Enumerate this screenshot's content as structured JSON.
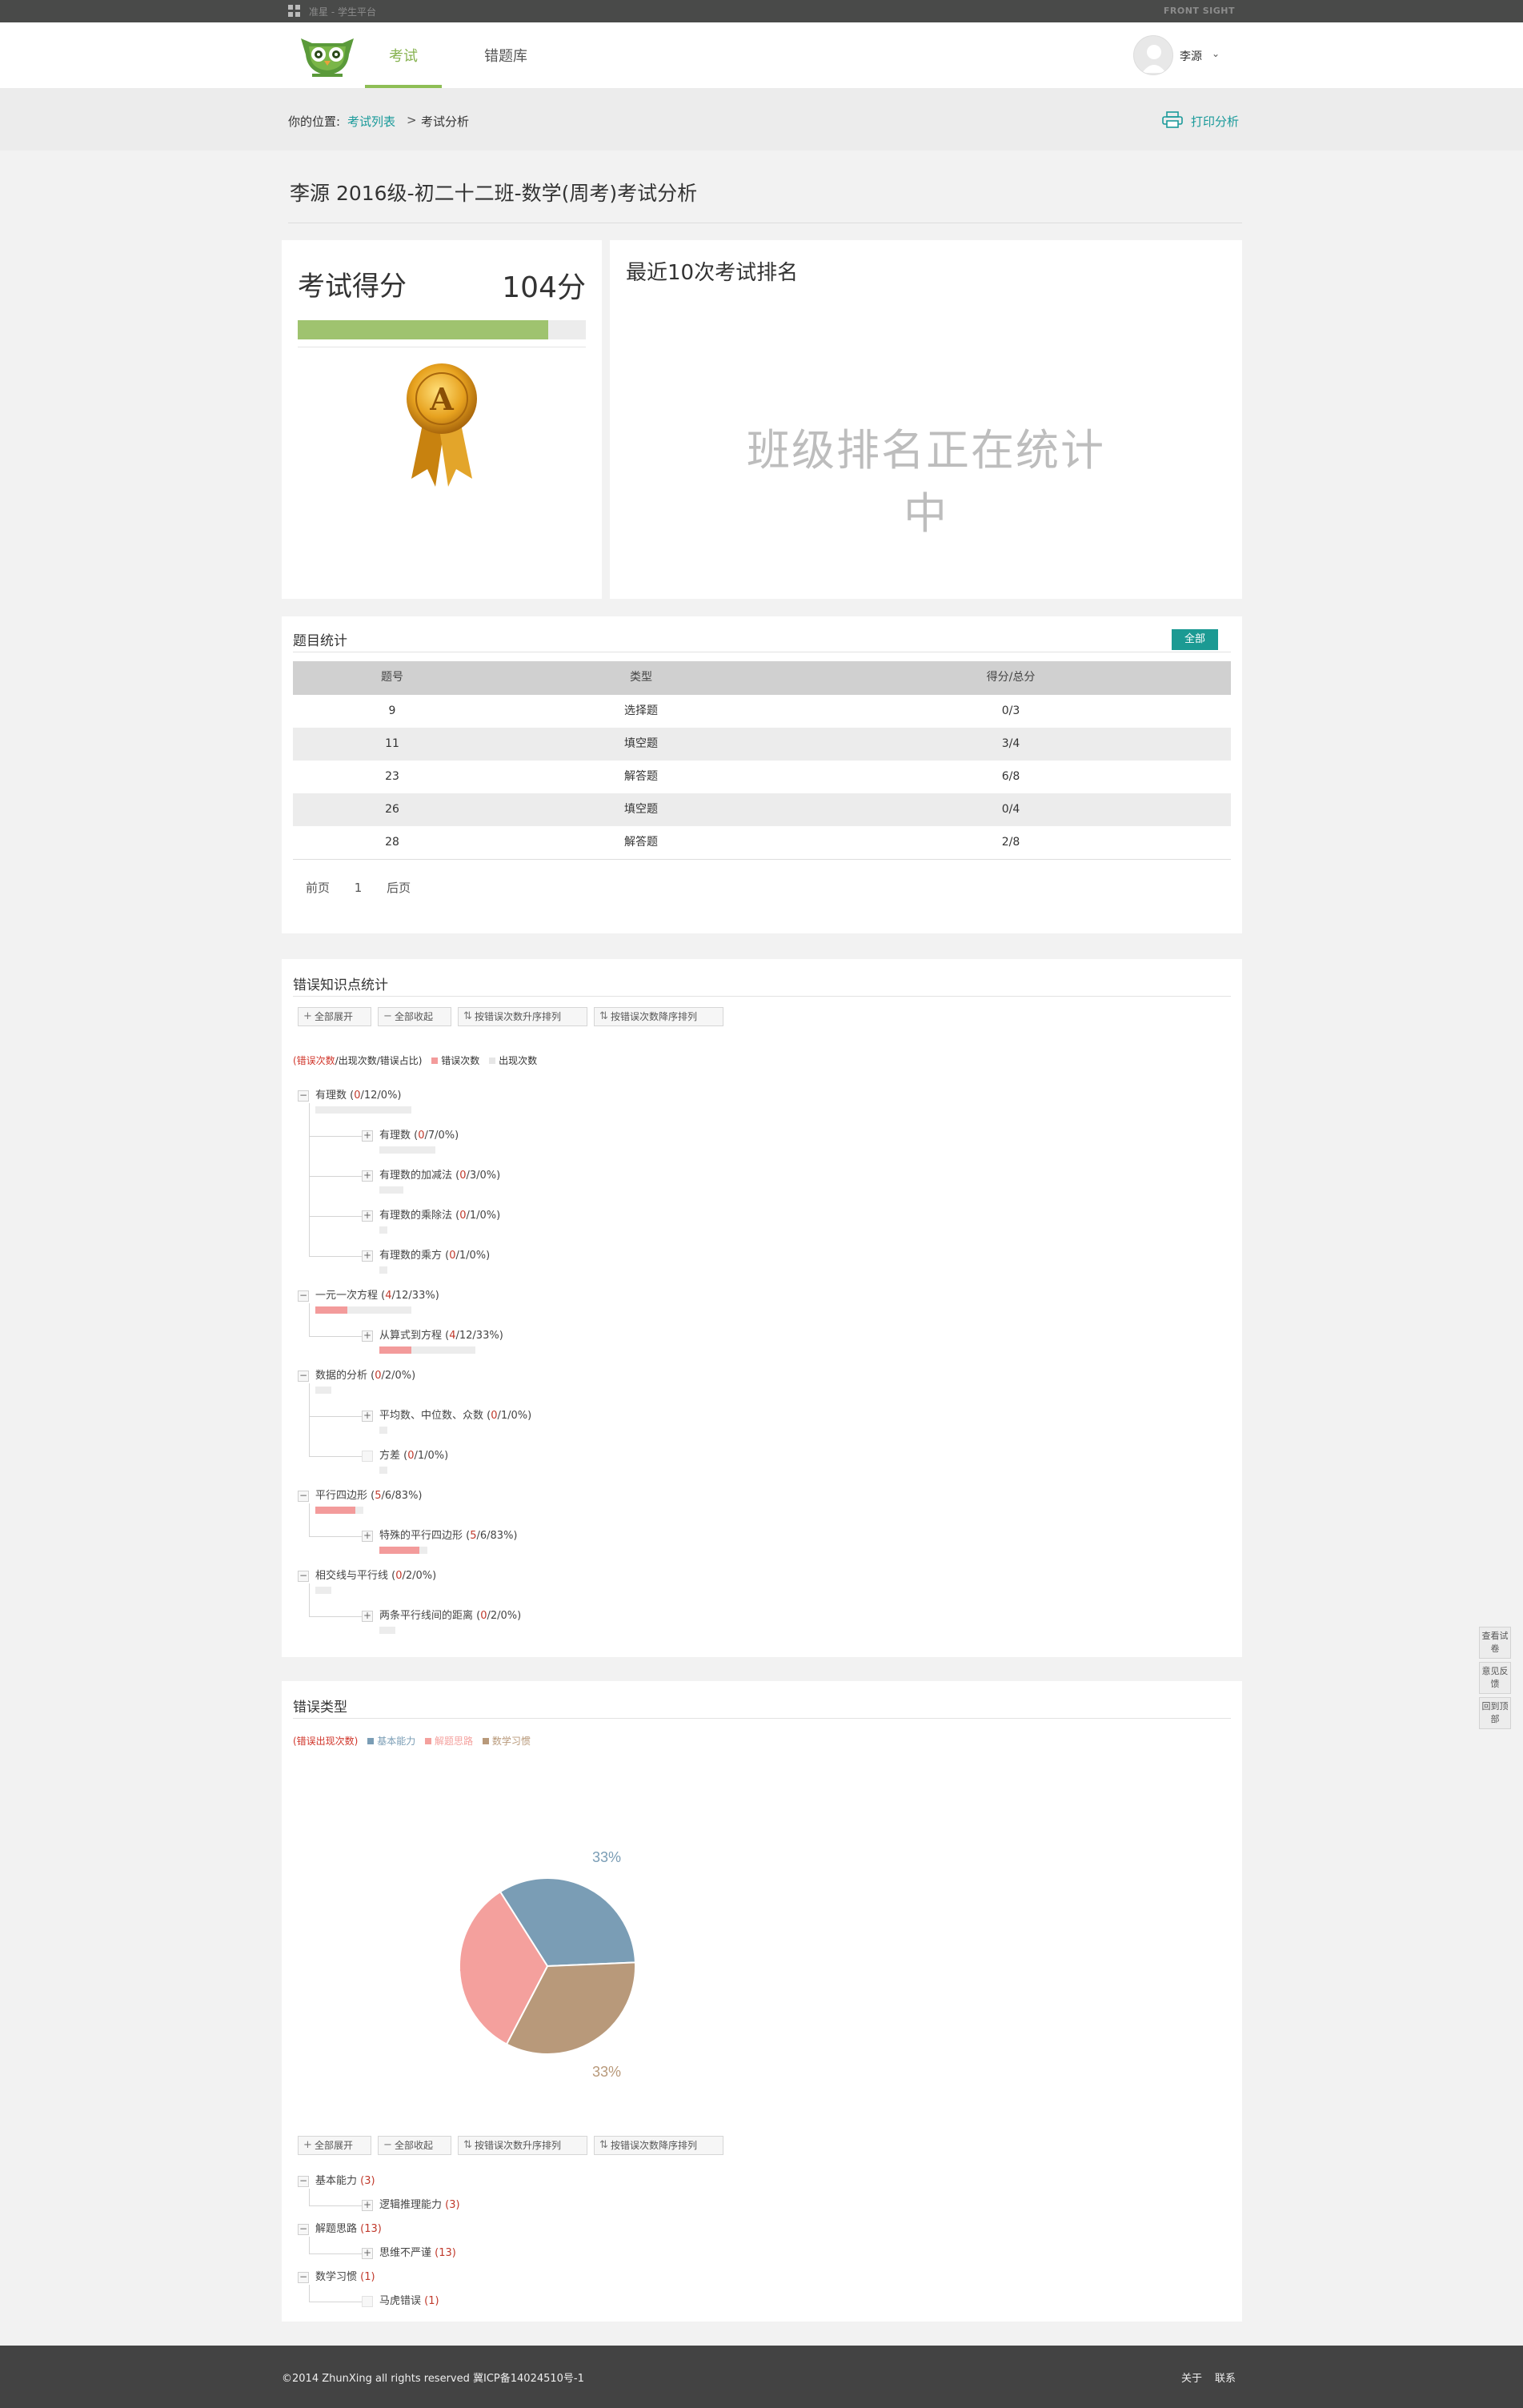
{
  "topbar": {
    "title": "准星 - 学生平台",
    "brand": "FRONT SIGHT"
  },
  "nav": {
    "tabs": [
      "考试",
      "错题库"
    ],
    "active": "考试"
  },
  "user": {
    "name": "李源"
  },
  "breadcrumb": {
    "label": "你的位置:",
    "link": "考试列表",
    "separator": ">",
    "current": "考试分析"
  },
  "print_label": "打印分析",
  "page_title": "李源 2016级-初二十二班-数学(周考)考试分析",
  "score": {
    "label": "考试得分",
    "value": "104分",
    "fraction": 0.87
  },
  "medal": {
    "letter": "A"
  },
  "rank": {
    "title": "最近10次考试排名",
    "status": "班级排名正在统计中"
  },
  "question_stats": {
    "title": "题目统计",
    "filter_label": "全部",
    "headers": [
      "题号",
      "类型",
      "得分/总分"
    ],
    "rows": [
      [
        "9",
        "选择题",
        "0/3"
      ],
      [
        "11",
        "填空题",
        "3/4"
      ],
      [
        "23",
        "解答题",
        "6/8"
      ],
      [
        "26",
        "填空题",
        "0/4"
      ],
      [
        "28",
        "解答题",
        "2/8"
      ]
    ],
    "pager": {
      "prev": "前页",
      "page": "1",
      "next": "后页"
    }
  },
  "toolbar": {
    "expand_all": "全部展开",
    "collapse_all": "全部收起",
    "sort_asc": "按错误次数升序排列",
    "sort_desc": "按错误次数降序排列"
  },
  "knowledge": {
    "title": "错误知识点统计",
    "legend": {
      "metric_red": "(错误次数",
      "metric_rest": "/出现次数/错误占比)",
      "wrong": "错误次数",
      "appear": "出现次数"
    },
    "colors": {
      "wrong": "#f39b9b",
      "appear": "#e6e6e6"
    },
    "nodes": [
      {
        "name": "有理数",
        "stat": "(0/12/0%)",
        "wrong": 0,
        "total": 12,
        "level": 0
      },
      {
        "name": "有理数",
        "stat": "(0/7/0%)",
        "wrong": 0,
        "total": 7,
        "level": 1
      },
      {
        "name": "有理数的加减法",
        "stat": "(0/3/0%)",
        "wrong": 0,
        "total": 3,
        "level": 1
      },
      {
        "name": "有理数的乘除法",
        "stat": "(0/1/0%)",
        "wrong": 0,
        "total": 1,
        "level": 1
      },
      {
        "name": "有理数的乘方",
        "stat": "(0/1/0%)",
        "wrong": 0,
        "total": 1,
        "level": 1
      },
      {
        "name": "一元一次方程",
        "stat": "(4/12/33%)",
        "wrong": 4,
        "total": 12,
        "level": 0
      },
      {
        "name": "从算式到方程",
        "stat": "(4/12/33%)",
        "wrong": 4,
        "total": 12,
        "level": 1
      },
      {
        "name": "数据的分析",
        "stat": "(0/2/0%)",
        "wrong": 0,
        "total": 2,
        "level": 0
      },
      {
        "name": "平均数、中位数、众数",
        "stat": "(0/1/0%)",
        "wrong": 0,
        "total": 1,
        "level": 1
      },
      {
        "name": "方差",
        "stat": "(0/1/0%)",
        "wrong": 0,
        "total": 1,
        "level": 1
      },
      {
        "name": "平行四边形",
        "stat": "(5/6/83%)",
        "wrong": 5,
        "total": 6,
        "level": 0
      },
      {
        "name": "特殊的平行四边形",
        "stat": "(5/6/83%)",
        "wrong": 5,
        "total": 6,
        "level": 1
      },
      {
        "name": "相交线与平行线",
        "stat": "(0/2/0%)",
        "wrong": 0,
        "total": 2,
        "level": 0
      },
      {
        "name": "两条平行线间的距离",
        "stat": "(0/2/0%)",
        "wrong": 0,
        "total": 2,
        "level": 1
      }
    ]
  },
  "error_types": {
    "title": "错误类型",
    "legend": {
      "metric": "(错误出现次数)",
      "items": [
        "基本能力",
        "解题思路",
        "数学习惯"
      ]
    },
    "colors": {
      "基本能力": "#7a9db5",
      "解题思路": "#f4a09d",
      "数学习惯": "#b8997a"
    },
    "tree": [
      {
        "name": "基本能力",
        "stat": "(3)",
        "level": 0
      },
      {
        "name": "逻辑推理能力",
        "stat": "(3)",
        "level": 1
      },
      {
        "name": "解题思路",
        "stat": "(13)",
        "level": 0
      },
      {
        "name": "思维不严谨",
        "stat": "(13)",
        "level": 1
      },
      {
        "name": "数学习惯",
        "stat": "(1)",
        "level": 0
      },
      {
        "name": "马虎错误",
        "stat": "(1)",
        "level": 1
      }
    ]
  },
  "chart_data": {
    "type": "pie",
    "title": "",
    "categories": [
      "基本能力",
      "解题思路",
      "数学习惯"
    ],
    "values": [
      33,
      33,
      33
    ],
    "labels": [
      "33%",
      "33%",
      "33%"
    ],
    "legend": "top-left"
  },
  "side_tools": [
    "查看试卷",
    "意见反馈",
    "回到顶部"
  ],
  "footer": {
    "copyright": "©2014 ZhunXing all rights reserved 冀ICP备14024510号-1",
    "about": "关于",
    "contact": "联系"
  }
}
